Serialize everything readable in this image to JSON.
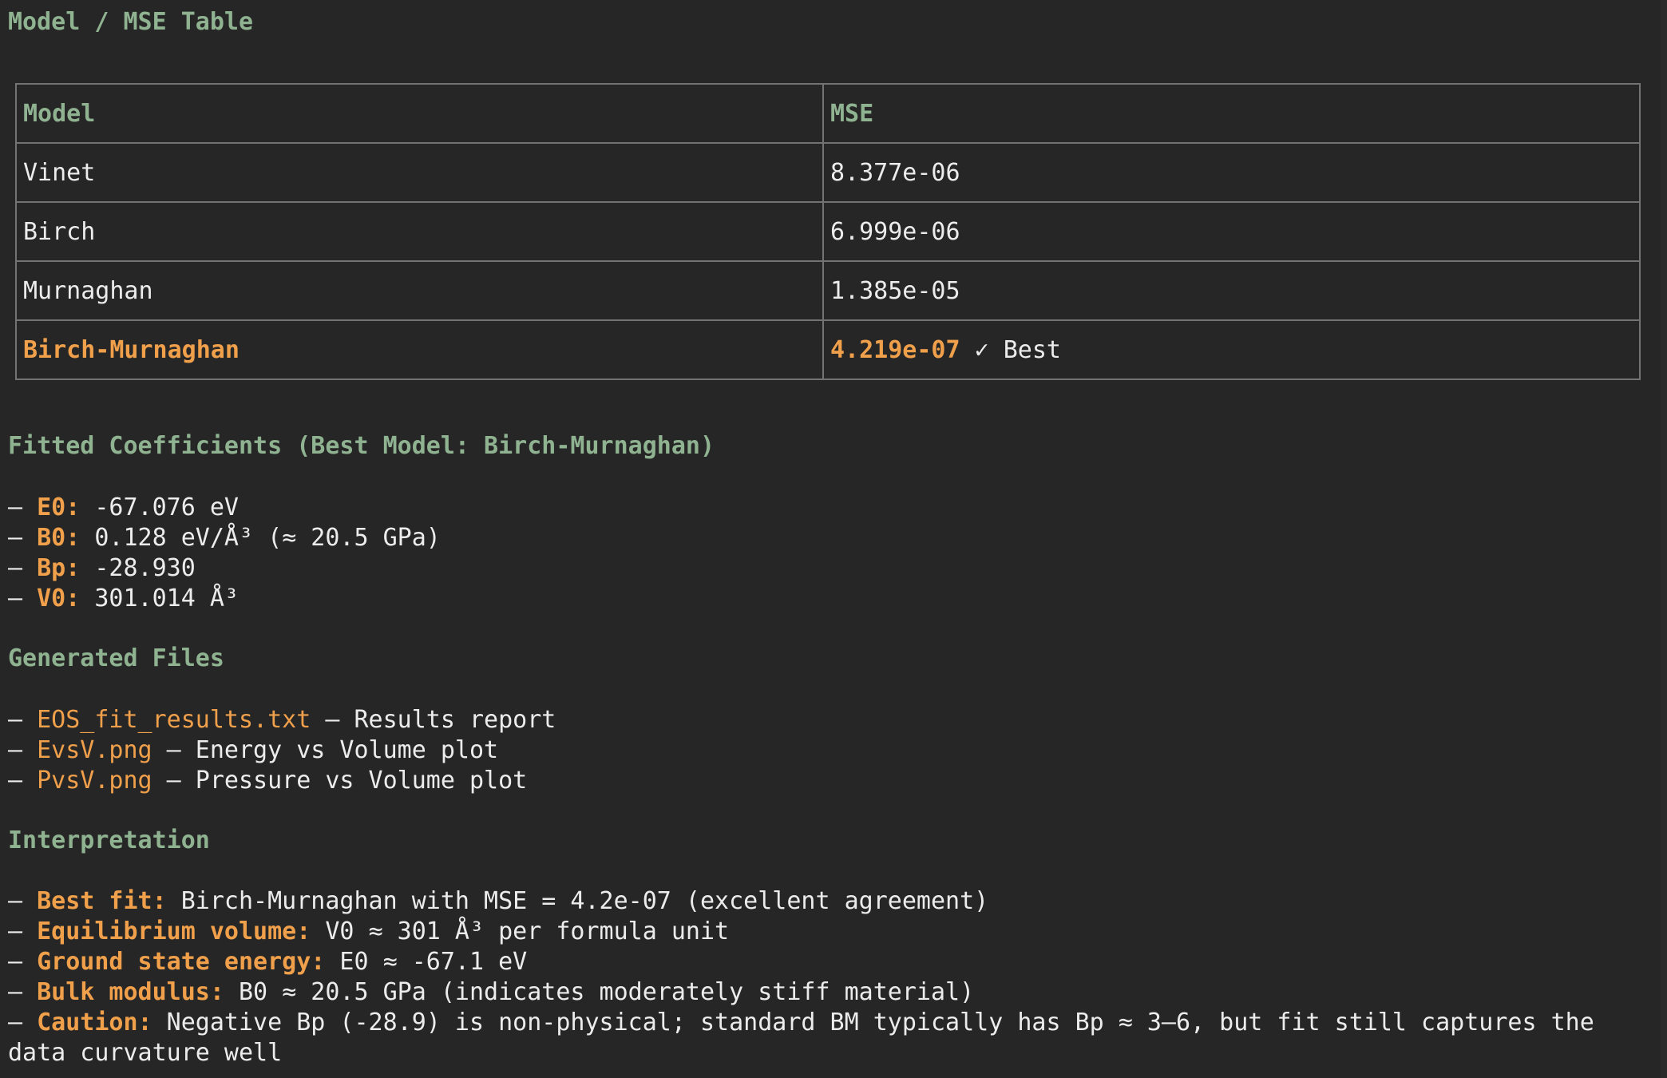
{
  "title": "Model / MSE Table",
  "table": {
    "headers": [
      "Model",
      "MSE"
    ],
    "rows": [
      {
        "model": "Vinet",
        "mse": "8.377e-06"
      },
      {
        "model": "Birch",
        "mse": "6.999e-06"
      },
      {
        "model": "Murnaghan",
        "mse": "1.385e-05"
      }
    ],
    "best_row": {
      "model": "Birch-Murnaghan",
      "mse": "4.219e-07",
      "badge": "✓ Best"
    }
  },
  "coefficients": {
    "heading": "Fitted Coefficients (Best Model: Birch-Murnaghan)",
    "items": [
      {
        "key": "E0:",
        "value": "-67.076 eV"
      },
      {
        "key": "B0:",
        "value": "0.128 eV/Å³ (≈ 20.5 GPa)"
      },
      {
        "key": "Bp:",
        "value": "-28.930"
      },
      {
        "key": "V0:",
        "value": "301.014 Å³"
      }
    ]
  },
  "files": {
    "heading": "Generated Files",
    "items": [
      {
        "name": "EOS_fit_results.txt",
        "desc": " – Results report"
      },
      {
        "name": "EvsV.png",
        "desc": " – Energy vs Volume plot"
      },
      {
        "name": "PvsV.png",
        "desc": " – Pressure vs Volume plot"
      }
    ]
  },
  "interpretation": {
    "heading": "Interpretation",
    "items": [
      {
        "key": "Best fit:",
        "value": " Birch-Murnaghan with MSE = 4.2e-07 (excellent agreement)"
      },
      {
        "key": "Equilibrium volume:",
        "value": " V0 ≈ 301 Å³ per formula unit"
      },
      {
        "key": "Ground state energy:",
        "value": " E0 ≈ -67.1 eV"
      },
      {
        "key": "Bulk modulus:",
        "value": " B0 ≈ 20.5 GPa (indicates moderately stiff material)"
      },
      {
        "key": "Caution:",
        "value": " Negative Bp (-28.9) is non-physical; standard BM typically has Bp ≈ 3–6, but fit still captures the data curvature well"
      }
    ]
  },
  "bullet": "– ",
  "colors": {
    "background": "#262626",
    "heading_green": "#8fb391",
    "accent_orange": "#f0a04b",
    "text": "#ececec",
    "table_border": "#737373"
  }
}
